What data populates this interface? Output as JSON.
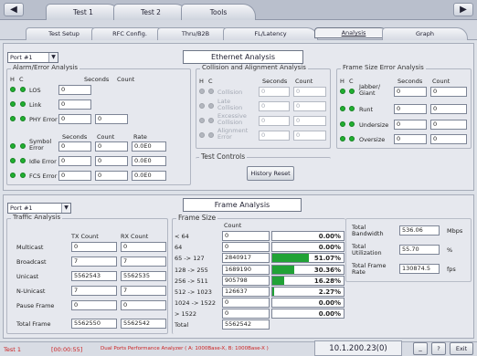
{
  "top_tabs": [
    "Test 1",
    "Test 2",
    "Tools"
  ],
  "sub_tabs": [
    "Test Setup",
    "RFC Config.",
    "Thru/B2B",
    "FL/Latency",
    "Analysis",
    "Graph"
  ],
  "ethernet": {
    "port": "Port #1",
    "title": "Ethernet Analysis",
    "alarm": {
      "legend": "Alarm/Error Analysis",
      "h": "H",
      "c": "C",
      "col_seconds": "Seconds",
      "col_count": "Count",
      "col_rate": "Rate",
      "rows": [
        {
          "label": "LOS",
          "seconds": "0",
          "count": ""
        },
        {
          "label": "Link",
          "seconds": "0",
          "count": ""
        },
        {
          "label": "PHY Error",
          "seconds": "0",
          "count": "0"
        }
      ],
      "symbol_rows": [
        {
          "label": "Symbol Error",
          "seconds": "0",
          "count": "0",
          "rate": "0.0E0"
        },
        {
          "label": "Idle Error",
          "seconds": "0",
          "count": "0",
          "rate": "0.0E0"
        },
        {
          "label": "FCS Error",
          "seconds": "0",
          "count": "0",
          "rate": "0.0E0"
        }
      ]
    },
    "collision": {
      "legend": "Collision and Alignment Analysis",
      "h": "H",
      "c": "C",
      "col_seconds": "Seconds",
      "col_count": "Count",
      "rows": [
        {
          "label": "Collision",
          "seconds": "0",
          "count": "0"
        },
        {
          "label": "Late Collision",
          "seconds": "0",
          "count": "0"
        },
        {
          "label": "Excessive Collision",
          "seconds": "0",
          "count": "0"
        },
        {
          "label": "Alignment Error",
          "seconds": "0",
          "count": "0"
        }
      ]
    },
    "test_controls": {
      "legend": "Test Controls",
      "button": "History Reset"
    },
    "frame_size_error": {
      "legend": "Frame Size Error Analysis",
      "h": "H",
      "c": "C",
      "col_seconds": "Seconds",
      "col_count": "Count",
      "rows": [
        {
          "label": "Jabber/ Giant",
          "seconds": "0",
          "count": "0"
        },
        {
          "label": "Runt",
          "seconds": "0",
          "count": "0"
        },
        {
          "label": "Undersize",
          "seconds": "0",
          "count": "0"
        },
        {
          "label": "Oversize",
          "seconds": "0",
          "count": "0"
        }
      ]
    }
  },
  "frame": {
    "port": "Port #1",
    "title": "Frame Analysis",
    "traffic": {
      "legend": "Traffic Analysis",
      "col_tx": "TX Count",
      "col_rx": "RX Count",
      "rows": [
        {
          "label": "Multicast",
          "tx": "0",
          "rx": "0"
        },
        {
          "label": "Broadcast",
          "tx": "7",
          "rx": "7"
        },
        {
          "label": "Unicast",
          "tx": "5562543",
          "rx": "5562535"
        },
        {
          "label": "N-Unicast",
          "tx": "7",
          "rx": "7"
        },
        {
          "label": "Pause Frame",
          "tx": "0",
          "rx": "0"
        }
      ],
      "total_label": "Total Frame",
      "total_tx": "5562550",
      "total_rx": "5562542"
    },
    "frame_size": {
      "legend": "Frame Size",
      "col_count": "Count",
      "rows": [
        {
          "label": "< 64",
          "count": "0",
          "pct": "0.00%",
          "value": 0
        },
        {
          "label": "64",
          "count": "0",
          "pct": "0.00%",
          "value": 0
        },
        {
          "label": "65 -> 127",
          "count": "2840917",
          "pct": "51.07%",
          "value": 51.07
        },
        {
          "label": "128 -> 255",
          "count": "1689190",
          "pct": "30.36%",
          "value": 30.36
        },
        {
          "label": "256 -> 511",
          "count": "905798",
          "pct": "16.28%",
          "value": 16.28
        },
        {
          "label": "512 -> 1023",
          "count": "126637",
          "pct": "2.27%",
          "value": 2.27
        },
        {
          "label": "1024 -> 1522",
          "count": "0",
          "pct": "0.00%",
          "value": 0
        },
        {
          "label": "> 1522",
          "count": "0",
          "pct": "0.00%",
          "value": 0
        }
      ],
      "total_label": "Total",
      "total_count": "5562542"
    },
    "summary": [
      {
        "label": "Total Bandwidth",
        "value": "536.06",
        "unit": "Mbps"
      },
      {
        "label": "Total Utilization",
        "value": "55.70",
        "unit": "%"
      },
      {
        "label": "Total Frame Rate",
        "value": "130874.5",
        "unit": "fps"
      }
    ]
  },
  "status": {
    "test": "Test 1",
    "time": "[00:00:55]",
    "message": "Dual Ports Performance Analyzer ( A: 1000Base-X, B: 1000Base-X )",
    "ip": "10.1.200.23(0)",
    "minimize": "_",
    "help": "?",
    "exit": "Exit"
  },
  "colors": {
    "bar": "#21a236",
    "led_on": "#20b030",
    "led_off": "#b3b7bf",
    "status_red": "#cc2020"
  }
}
